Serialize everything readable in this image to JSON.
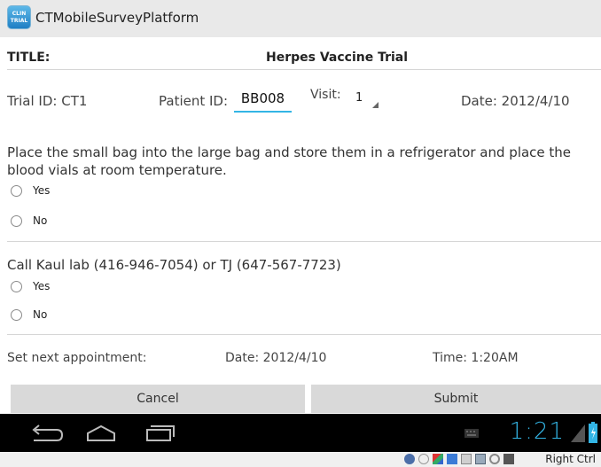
{
  "app": {
    "title": "CTMobileSurveyPlatform",
    "icon_text_line1": "CLIN",
    "icon_text_line2": "TRIAL"
  },
  "form": {
    "title_label": "TITLE:",
    "title_value": "Herpes Vaccine Trial",
    "trial_id": "Trial ID: CT1",
    "patient_id_label": "Patient ID:",
    "patient_id_value": "BB008",
    "visit_label": "Visit:",
    "visit_value": "1",
    "date": "Date: 2012/4/10"
  },
  "questions": [
    {
      "text": "Place the small bag into the large bag and store them in a refrigerator and place the blood vials at room temperature.",
      "options": [
        "Yes",
        "No"
      ]
    },
    {
      "text": "Call Kaul lab (416-946-7054) or TJ (647-567-7723)",
      "options": [
        "Yes",
        "No"
      ]
    }
  ],
  "appointment": {
    "label": "Set next appointment:",
    "date": "Date: 2012/4/10",
    "time": "Time: 1:20AM"
  },
  "buttons": {
    "cancel": "Cancel",
    "submit": "Submit"
  },
  "navbar": {
    "clock": "1:21"
  },
  "host": {
    "right_ctrl": "Right Ctrl"
  },
  "colors": {
    "accent": "#33b5e5",
    "actionbar": "#e9e9e9",
    "button": "#d9d9d9",
    "navbar": "#000000"
  }
}
